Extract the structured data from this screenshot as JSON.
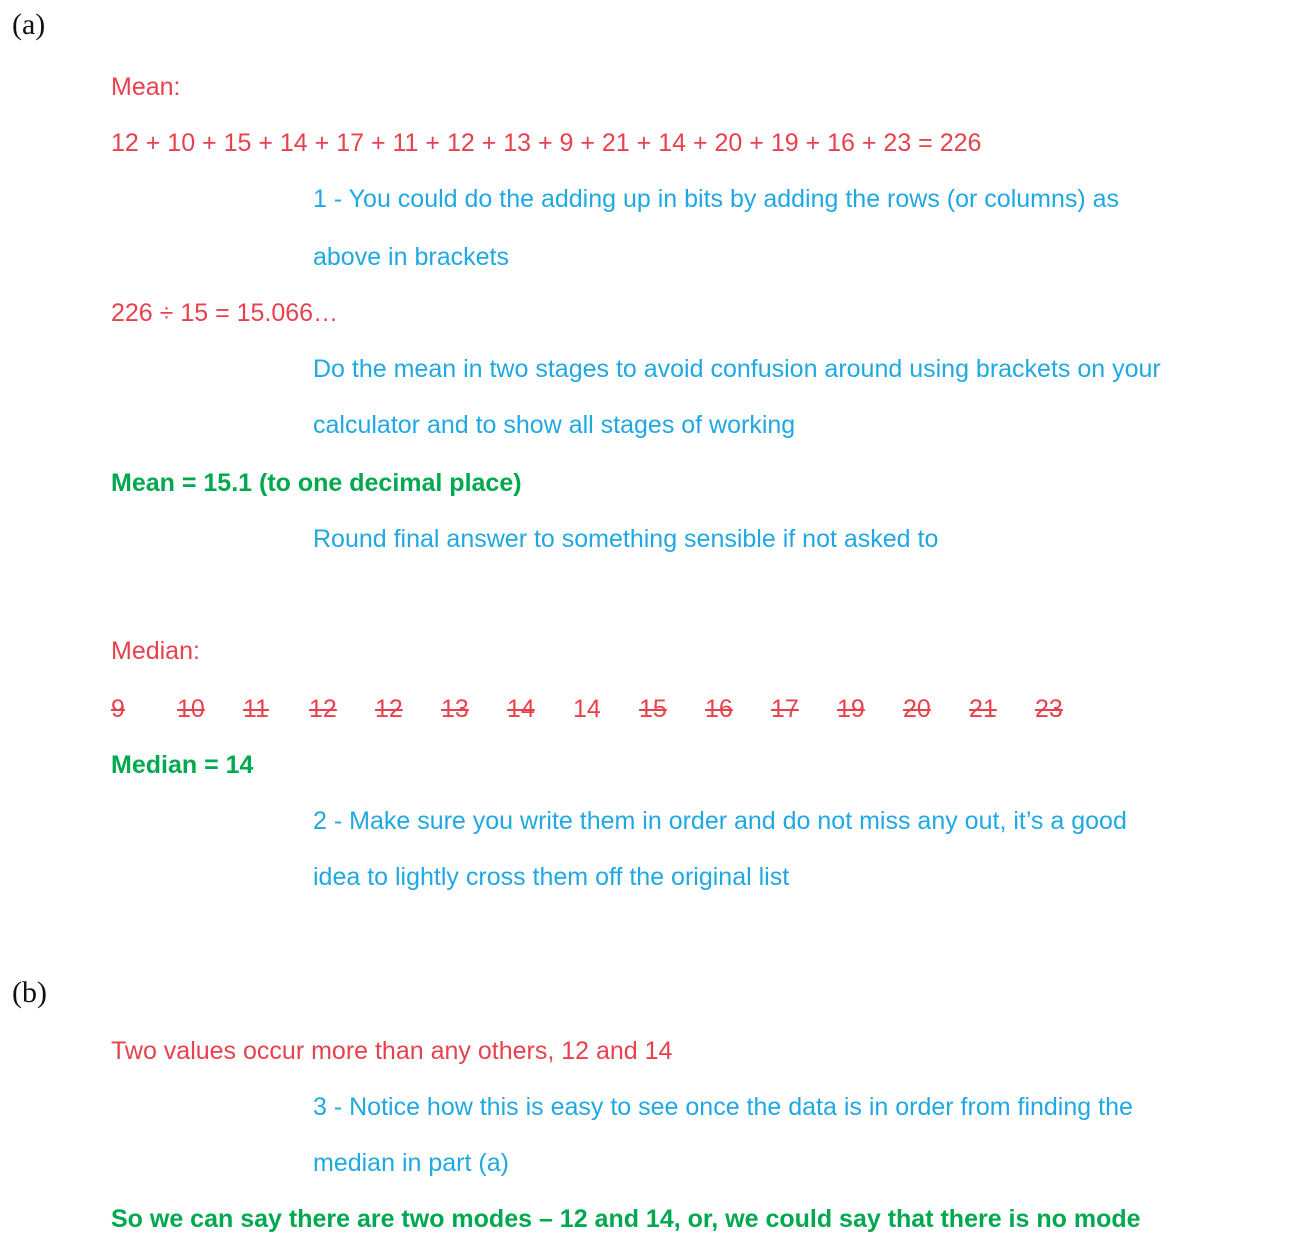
{
  "part_a": {
    "label": "(a)",
    "mean_heading": "Mean:",
    "sum_line": "12 + 10 + 15 + 14 + 17 + 11 + 12 + 13 + 9 + 21 + 14 + 20 + 19 + 16 + 23 = 226",
    "note1_line1": "1 - You could do the adding up in bits by adding the rows (or columns) as",
    "note1_line2": "above in brackets",
    "division_line": "226 ÷ 15 = 15.066…",
    "note2_line1": "Do the mean in two stages to avoid confusion around using brackets on your",
    "note2_line2": "calculator and to show all stages of working",
    "mean_answer": "Mean = 15.1  (to one decimal place)",
    "note3": "Round final answer to something sensible if not asked to",
    "median_heading": "Median:",
    "sorted_values": [
      {
        "value": "9",
        "struck": true
      },
      {
        "value": "10",
        "struck": true
      },
      {
        "value": "11",
        "struck": true
      },
      {
        "value": "12",
        "struck": true
      },
      {
        "value": "12",
        "struck": true
      },
      {
        "value": "13",
        "struck": true
      },
      {
        "value": "14",
        "struck": true
      },
      {
        "value": "14",
        "struck": false
      },
      {
        "value": "15",
        "struck": true
      },
      {
        "value": "16",
        "struck": true
      },
      {
        "value": "17",
        "struck": true
      },
      {
        "value": "19",
        "struck": true
      },
      {
        "value": "20",
        "struck": true
      },
      {
        "value": "21",
        "struck": true
      },
      {
        "value": "23",
        "struck": true
      }
    ],
    "median_answer": "Median = 14",
    "note4_line1": "2 - Make sure you write them in order and do not miss any out, it’s a good",
    "note4_line2": "idea to lightly cross them off the original list"
  },
  "part_b": {
    "label": "(b)",
    "statement": "Two values occur more than any others, 12 and 14",
    "note_line1": "3 - Notice how this is easy to see once the data is in order from finding the",
    "note_line2": "median in part (a)",
    "answer": "So we can say there are two modes – 12 and 14, or, we could say that there is no mode"
  },
  "colors": {
    "working": "#E8414E",
    "notes": "#1FA8E2",
    "answers": "#00A84F"
  }
}
